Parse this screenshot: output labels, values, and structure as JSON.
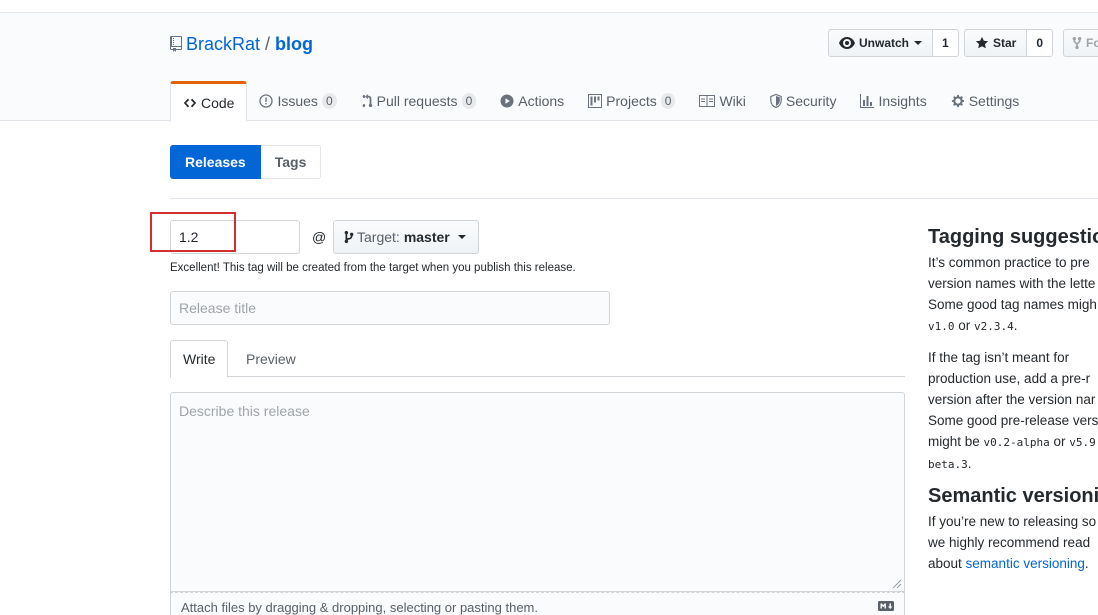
{
  "repo": {
    "owner": "BrackRat",
    "separator": "/",
    "name": "blog"
  },
  "actions": {
    "watch": {
      "label": "Unwatch",
      "count": "1"
    },
    "star": {
      "label": "Star",
      "count": "0"
    },
    "fork": {
      "label": "Fo"
    }
  },
  "tabs": [
    {
      "label": "Code"
    },
    {
      "label": "Issues",
      "count": "0"
    },
    {
      "label": "Pull requests",
      "count": "0"
    },
    {
      "label": "Actions"
    },
    {
      "label": "Projects",
      "count": "0"
    },
    {
      "label": "Wiki"
    },
    {
      "label": "Security"
    },
    {
      "label": "Insights"
    },
    {
      "label": "Settings"
    }
  ],
  "subnav": {
    "releases": "Releases",
    "tags": "Tags"
  },
  "form": {
    "tag_value": "1.2",
    "at": "@",
    "target_label": "Target:",
    "target_value": "master",
    "tag_note": "Excellent! This tag will be created from the target when you publish this release.",
    "title_placeholder": "Release title",
    "write_tab": "Write",
    "preview_tab": "Preview",
    "body_placeholder": "Describe this release",
    "attach_text": "Attach files by dragging & dropping, selecting or pasting them."
  },
  "sidebar": {
    "tagging_heading": "Tagging suggestion",
    "tagging_lines": [
      "It’s common practice to pre",
      "version names with the lette",
      "Some good tag names migh"
    ],
    "tag_example_1": "v1.0",
    "tag_example_or": " or ",
    "tag_example_2": "v2.3.4",
    "tag_example_end": ".",
    "prerelease_lines": [
      "If the tag isn’t meant for",
      "production use, add a pre-r",
      "version after the version nar",
      "Some good pre-release vers"
    ],
    "prerelease_might": "might be ",
    "pre_example_1": "v0.2-alpha",
    "pre_example_or": " or ",
    "pre_example_2": "v5.9",
    "pre_example_3": "beta.3",
    "pre_example_end": ".",
    "semver_heading": "Semantic versionin",
    "semver_lines": [
      "If you’re new to releasing so",
      "we highly recommend read"
    ],
    "semver_about": "about ",
    "semver_link": "semantic versioning",
    "semver_end": "."
  }
}
